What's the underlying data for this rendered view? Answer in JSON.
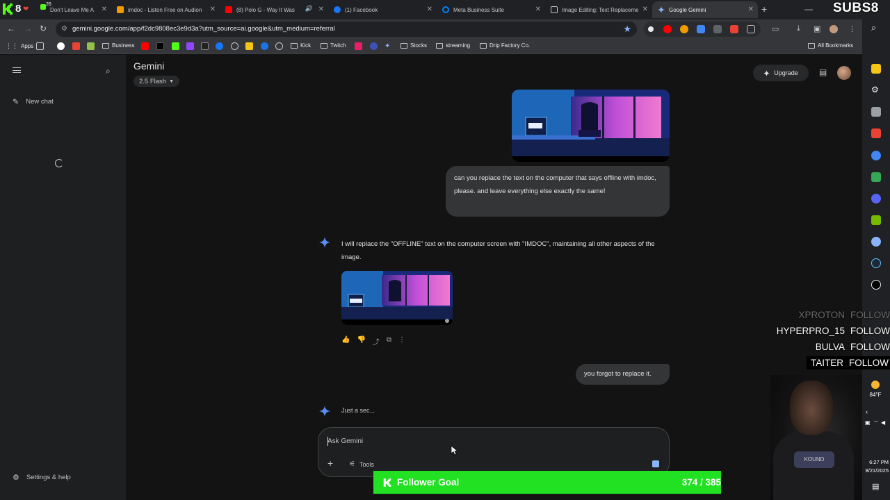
{
  "browser": {
    "tabs": [
      {
        "title": "Don't Leave Me A",
        "icon": "music-icon",
        "color": "#ffffff"
      },
      {
        "title": "imdoc - Listen Free on Audion",
        "icon": "audible-icon",
        "color": "#f29b00"
      },
      {
        "title": "(8) Polo G - Way It Was (Of",
        "icon": "youtube-icon",
        "color": "#ff0000"
      },
      {
        "title": "(1) Facebook",
        "icon": "facebook-icon",
        "color": "#1877f2"
      },
      {
        "title": "Meta Business Suite",
        "icon": "meta-icon",
        "color": "#0081fb"
      },
      {
        "title": "Image Editing: Text Replaceme",
        "icon": "gemini-tab-icon",
        "color": "#c4c7c5"
      },
      {
        "title": "Google Gemini",
        "icon": "gemini-icon",
        "color": "#8ab4f8"
      }
    ],
    "url": "gemini.google.com/app/f2dc9808ec3e9d3a?utm_source=ai.google&utm_medium=referral",
    "bookmarks": {
      "apps": "Apps",
      "business": "Business",
      "kick": "Kick",
      "twitch": "Twitch",
      "stocks": "Stocks",
      "streaming": "streaming",
      "drip": "Drip Factory Co.",
      "all": "All Bookmarks"
    }
  },
  "gemini": {
    "title": "Gemini",
    "model": "2.5 Flash",
    "upgrade": "Upgrade",
    "new_chat": "New chat",
    "settings": "Settings & help",
    "input_placeholder": "Ask Gemini",
    "tools": "Tools",
    "messages": {
      "user_1": "can you replace the text on the computer that says offline with imdoc, please. and leave everything else exactly the same!",
      "model_1": "I will replace the \"OFFLINE\" text on the computer screen with \"IMDOC\", maintaining all other aspects of the image.",
      "user_2": "you forgot to replace it.",
      "model_2": "Just a sec..."
    }
  },
  "overlay": {
    "logo_count": "8",
    "subs_badge": "SUBS",
    "subs_count": "8",
    "mini_count": "26",
    "followers": [
      {
        "name": "XPROTON",
        "label": "FOLLOW"
      },
      {
        "name": "HYPERPRO_15",
        "label": "FOLLOW"
      },
      {
        "name": "BULVA",
        "label": "FOLLOW"
      },
      {
        "name": "TAITER",
        "label": "FOLLOW"
      }
    ],
    "goal_title": "Follower Goal",
    "goal_count": "374 / 385",
    "weather": "84°F",
    "time": "6:27 PM",
    "date": "8/21/2025",
    "shirt": "KOUND"
  },
  "colors": {
    "accent": "#8ab4f8",
    "kick_green": "#22e022",
    "bg": "#131314"
  }
}
